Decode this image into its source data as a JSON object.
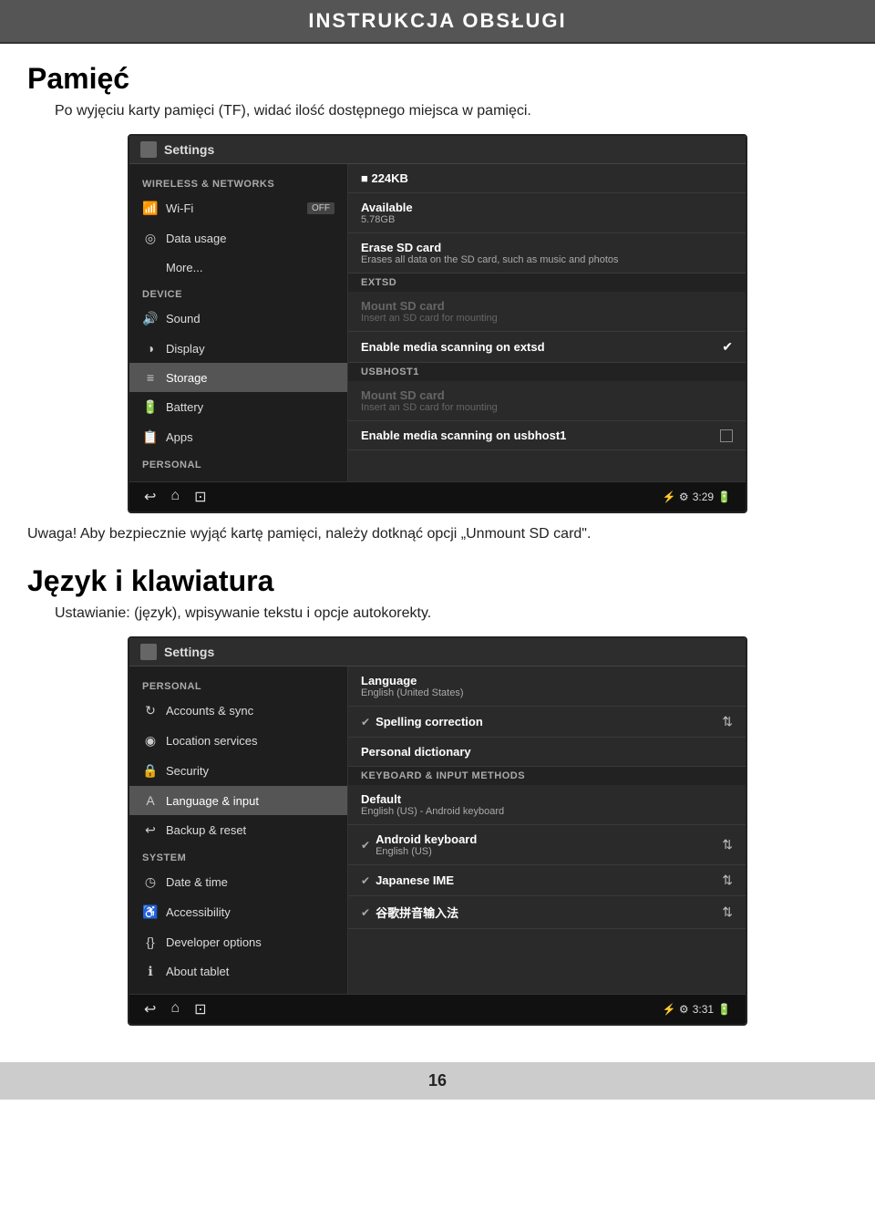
{
  "header": {
    "title": "INSTRUKCJA OBSŁUGI"
  },
  "section1": {
    "title": "Pamięć",
    "desc": "Po wyjęciu karty pamięci (TF), widać ilość dostępnego miejsca w pamięci.",
    "note": "Uwaga! Aby bezpiecznie wyjąć kartę pamięci, należy dotknąć opcji „Unmount SD card\".",
    "screenshot": {
      "titlebar": "Settings",
      "sidebar": {
        "sections": [
          {
            "label": "WIRELESS & NETWORKS",
            "items": [
              {
                "icon": "📶",
                "label": "Wi-Fi",
                "extra": "OFF",
                "active": false
              },
              {
                "icon": "◎",
                "label": "Data usage",
                "active": false
              },
              {
                "icon": "",
                "label": "More...",
                "active": false
              }
            ]
          },
          {
            "label": "DEVICE",
            "items": [
              {
                "icon": "🔊",
                "label": "Sound",
                "active": false
              },
              {
                "icon": "◑",
                "label": "Display",
                "active": false
              },
              {
                "icon": "≡",
                "label": "Storage",
                "active": true
              },
              {
                "icon": "🔋",
                "label": "Battery",
                "active": false
              },
              {
                "icon": "📋",
                "label": "Apps",
                "active": false
              }
            ]
          },
          {
            "label": "PERSONAL",
            "items": []
          }
        ]
      },
      "content": {
        "items": [
          {
            "type": "value",
            "title": "224KB",
            "sub": ""
          },
          {
            "type": "item",
            "title": "Available",
            "sub": "5.78GB"
          },
          {
            "type": "item",
            "title": "Erase SD card",
            "sub": "Erases all data on the SD card, such as music and photos"
          },
          {
            "type": "section",
            "label": "EXTSD"
          },
          {
            "type": "item-grey",
            "title": "Mount SD card",
            "sub": "Insert an SD card for mounting"
          },
          {
            "type": "item-check",
            "title": "Enable media scanning on extsd",
            "checked": true
          },
          {
            "type": "section",
            "label": "USBHOST1"
          },
          {
            "type": "item-grey",
            "title": "Mount SD card",
            "sub": "Insert an SD card for mounting"
          },
          {
            "type": "item-checkbox",
            "title": "Enable media scanning on usbhost1",
            "checked": false
          }
        ]
      },
      "navbar": {
        "back": "↩",
        "home": "⌂",
        "recent": "⊡",
        "time": "3:29"
      }
    }
  },
  "section2": {
    "title": "Język i klawiatura",
    "desc": "Ustawianie: (język), wpisywanie tekstu i opcje autokorekty.",
    "screenshot": {
      "titlebar": "Settings",
      "sidebar": {
        "sections": [
          {
            "label": "PERSONAL",
            "items": [
              {
                "icon": "↻",
                "label": "Accounts & sync",
                "active": false
              },
              {
                "icon": "◉",
                "label": "Location services",
                "active": false
              },
              {
                "icon": "🔒",
                "label": "Security",
                "active": false
              },
              {
                "icon": "A",
                "label": "Language & input",
                "active": true
              },
              {
                "icon": "↩",
                "label": "Backup & reset",
                "active": false
              }
            ]
          },
          {
            "label": "SYSTEM",
            "items": [
              {
                "icon": "◷",
                "label": "Date & time",
                "active": false
              },
              {
                "icon": "♿",
                "label": "Accessibility",
                "active": false
              },
              {
                "icon": "{}",
                "label": "Developer options",
                "active": false
              },
              {
                "icon": "ℹ",
                "label": "About tablet",
                "active": false
              }
            ]
          }
        ]
      },
      "content": {
        "items": [
          {
            "type": "item",
            "title": "Language",
            "sub": "English (United States)"
          },
          {
            "type": "item-check2",
            "title": "Spelling correction",
            "checked": true
          },
          {
            "type": "item",
            "title": "Personal dictionary",
            "sub": ""
          },
          {
            "type": "section",
            "label": "KEYBOARD & INPUT METHODS"
          },
          {
            "type": "item-bold",
            "title": "Default",
            "sub": "English (US) - Android keyboard"
          },
          {
            "type": "item-check-settings",
            "title": "Android keyboard",
            "sub": "English (US)",
            "checked": true
          },
          {
            "type": "item-check-settings",
            "title": "Japanese IME",
            "sub": "",
            "checked": true
          },
          {
            "type": "item-check-settings",
            "title": "谷歌拼音输入法",
            "sub": "",
            "checked": true
          }
        ]
      },
      "navbar": {
        "back": "↩",
        "home": "⌂",
        "recent": "⊡",
        "time": "3:31"
      }
    }
  },
  "footer": {
    "page_number": "16"
  }
}
